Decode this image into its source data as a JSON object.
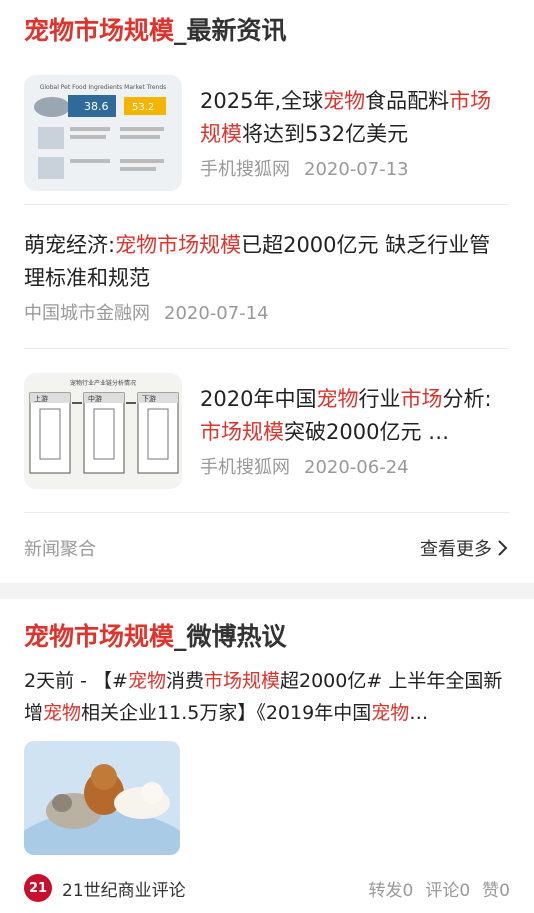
{
  "news_section": {
    "title_highlight": "宠物市场规模",
    "title_rest": "_最新资讯",
    "items": [
      {
        "title_parts": [
          "2025年,全球",
          "宠物",
          "食品配料",
          "市场规模",
          "将达到532亿美元"
        ],
        "source": "手机搜狐网",
        "date": "2020-07-13",
        "thumb_caption": "Global Pet Food Ingredients Market Trends",
        "thumb_num_a": "38.6",
        "thumb_num_b": "53.2"
      },
      {
        "title_parts": [
          "萌宠经济:",
          "宠物市场规模",
          "已超2000亿元 缺乏行业管理标准和规范"
        ],
        "source": "中国城市金融网",
        "date": "2020-07-14"
      },
      {
        "title_parts": [
          "2020年中国",
          "宠物",
          "行业",
          "市场",
          "分析:",
          "市场规模",
          "突破2000亿元 …"
        ],
        "source": "手机搜狐网",
        "date": "2020-06-24",
        "thumb_caption": "宠物行业产业链分析情况",
        "thumb_cols": [
          "上游",
          "中游",
          "下游"
        ]
      }
    ],
    "footer_left": "新闻聚合",
    "footer_right": "查看更多"
  },
  "weibo_section": {
    "title_highlight": "宠物市场规模",
    "title_rest": "_微博热议",
    "text_parts": [
      "2天前 - 【#",
      "宠物",
      "消费",
      "市场规模",
      "超2000亿# 上半年全国新增",
      "宠物",
      "相关企业11.5万家】《2019年中国",
      "宠物",
      "…"
    ],
    "source_name": "21世纪商业评论",
    "source_logo": "21",
    "repost": "转发0",
    "comment": "评论0",
    "like": "赞0"
  }
}
